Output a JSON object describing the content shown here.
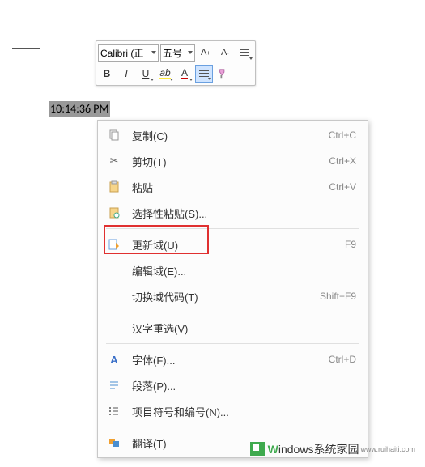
{
  "toolbar": {
    "font_name": "Calibri (正",
    "font_size": "五号",
    "bold": "B",
    "italic": "I",
    "underline": "U",
    "highlight_glyph": "ab",
    "fontcolor_glyph": "A",
    "grow": "A",
    "shrink": "A"
  },
  "selection": {
    "time_text": "10:14:36 PM"
  },
  "menu": {
    "copy": {
      "label": "复制(C)",
      "shortcut": "Ctrl+C"
    },
    "cut": {
      "label": "剪切(T)",
      "shortcut": "Ctrl+X"
    },
    "paste": {
      "label": "粘贴",
      "shortcut": "Ctrl+V"
    },
    "paste_special": {
      "label": "选择性粘贴(S)..."
    },
    "update_field": {
      "label": "更新域(U)",
      "shortcut": "F9"
    },
    "edit_field": {
      "label": "编辑域(E)..."
    },
    "toggle_field": {
      "label": "切换域代码(T)",
      "shortcut": "Shift+F9"
    },
    "reconvert": {
      "label": "汉字重选(V)"
    },
    "font": {
      "label": "字体(F)...",
      "shortcut": "Ctrl+D"
    },
    "paragraph": {
      "label": "段落(P)..."
    },
    "bullets": {
      "label": "项目符号和编号(N)..."
    },
    "translate": {
      "label": "翻译(T)"
    }
  },
  "watermark": {
    "brand_w": "W",
    "brand_rest": "indows",
    "suffix": "系统家园",
    "url": "www.ruihaiti.com"
  }
}
